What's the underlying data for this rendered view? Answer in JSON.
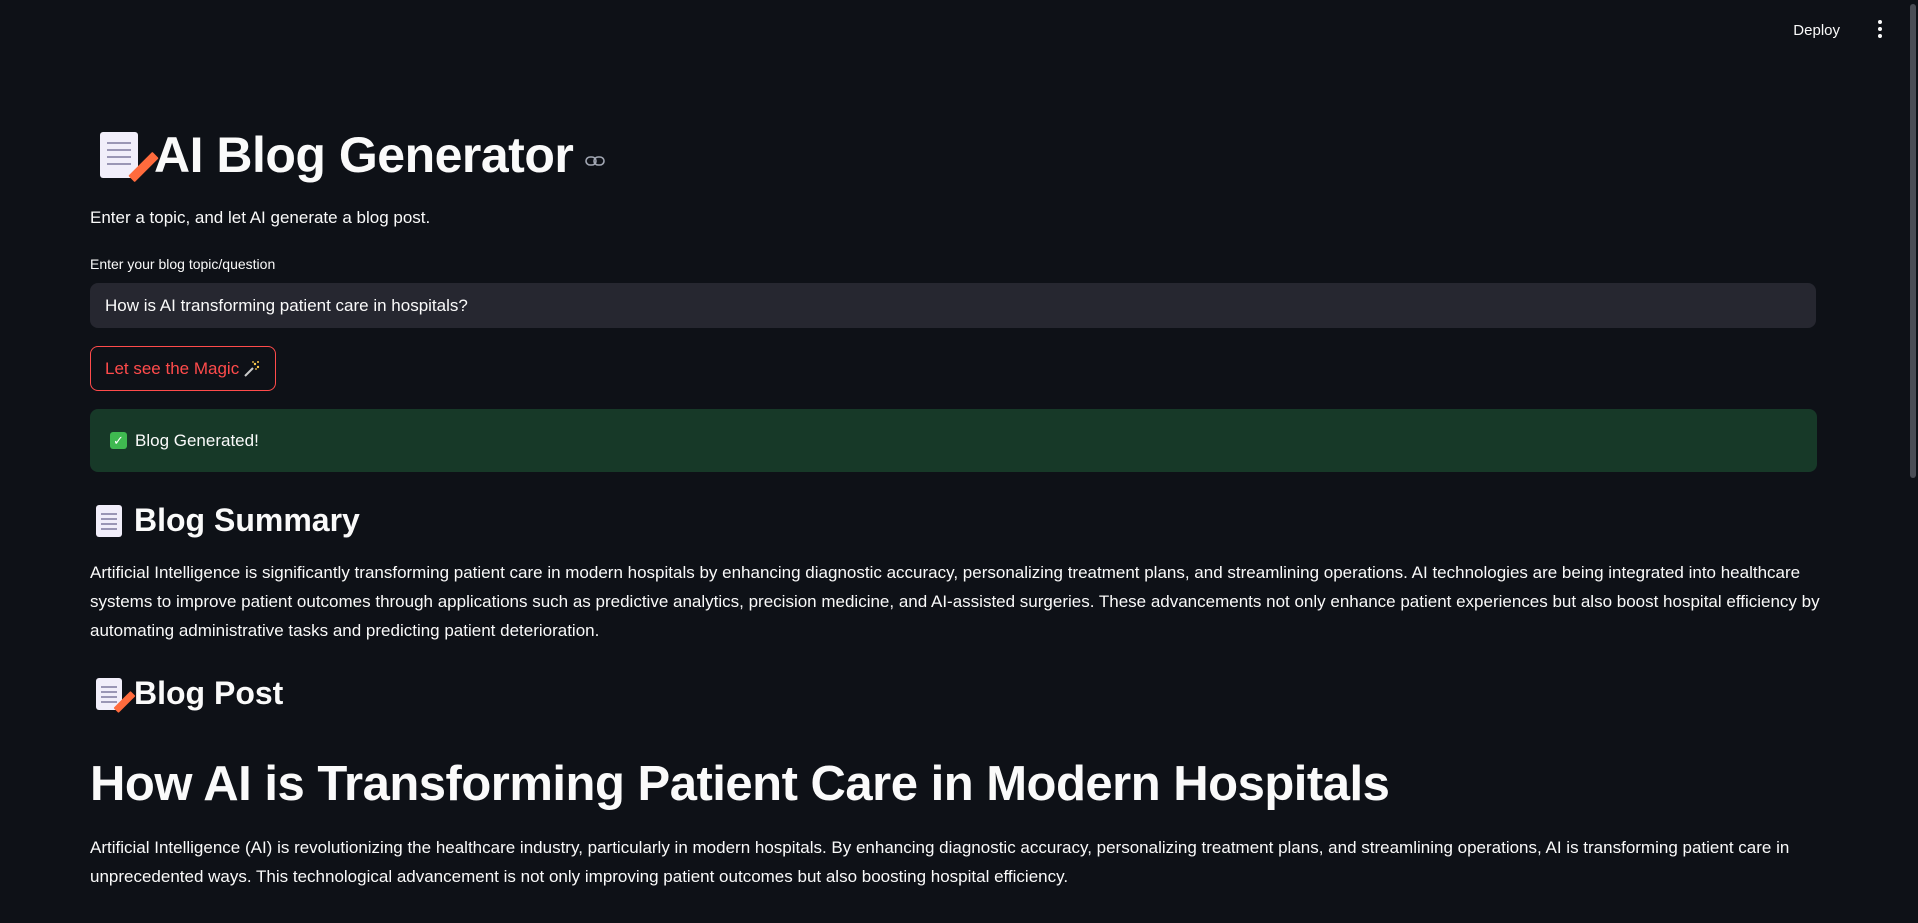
{
  "toolbar": {
    "deploy_label": "Deploy",
    "menu_icon": "kebab-menu-icon"
  },
  "header": {
    "title_icon": "memo-emoji-icon",
    "title": "AI Blog Generator",
    "anchor_icon": "link-icon",
    "subtitle": "Enter a topic, and let AI generate a blog post."
  },
  "form": {
    "topic_label": "Enter your blog topic/question",
    "topic_value": "How is AI transforming patient care in hospitals?",
    "submit_label": "Let see the Magic",
    "submit_icon": "sparkles-icon"
  },
  "status": {
    "icon": "check-mark-icon",
    "message": "Blog Generated!",
    "color": "#173928"
  },
  "summary": {
    "icon": "page-emoji-icon",
    "heading": "Blog Summary",
    "text": "Artificial Intelligence is significantly transforming patient care in modern hospitals by enhancing diagnostic accuracy, personalizing treatment plans, and streamlining operations. AI technologies are being integrated into healthcare systems to improve patient outcomes through applications such as predictive analytics, precision medicine, and AI-assisted surgeries. These advancements not only enhance patient experiences but also boost hospital efficiency by automating administrative tasks and predicting patient deterioration."
  },
  "post": {
    "icon": "memo-emoji-icon",
    "heading": "Blog Post",
    "title": "How AI is Transforming Patient Care in Modern Hospitals",
    "intro": "Artificial Intelligence (AI) is revolutionizing the healthcare industry, particularly in modern hospitals. By enhancing diagnostic accuracy, personalizing treatment plans, and streamlining operations, AI is transforming patient care in unprecedented ways. This technological advancement is not only improving patient outcomes but also boosting hospital efficiency."
  },
  "colors": {
    "background": "#0e1117",
    "accent": "#ff4b4b",
    "input_bg": "#262730",
    "success_bg": "#173928"
  }
}
